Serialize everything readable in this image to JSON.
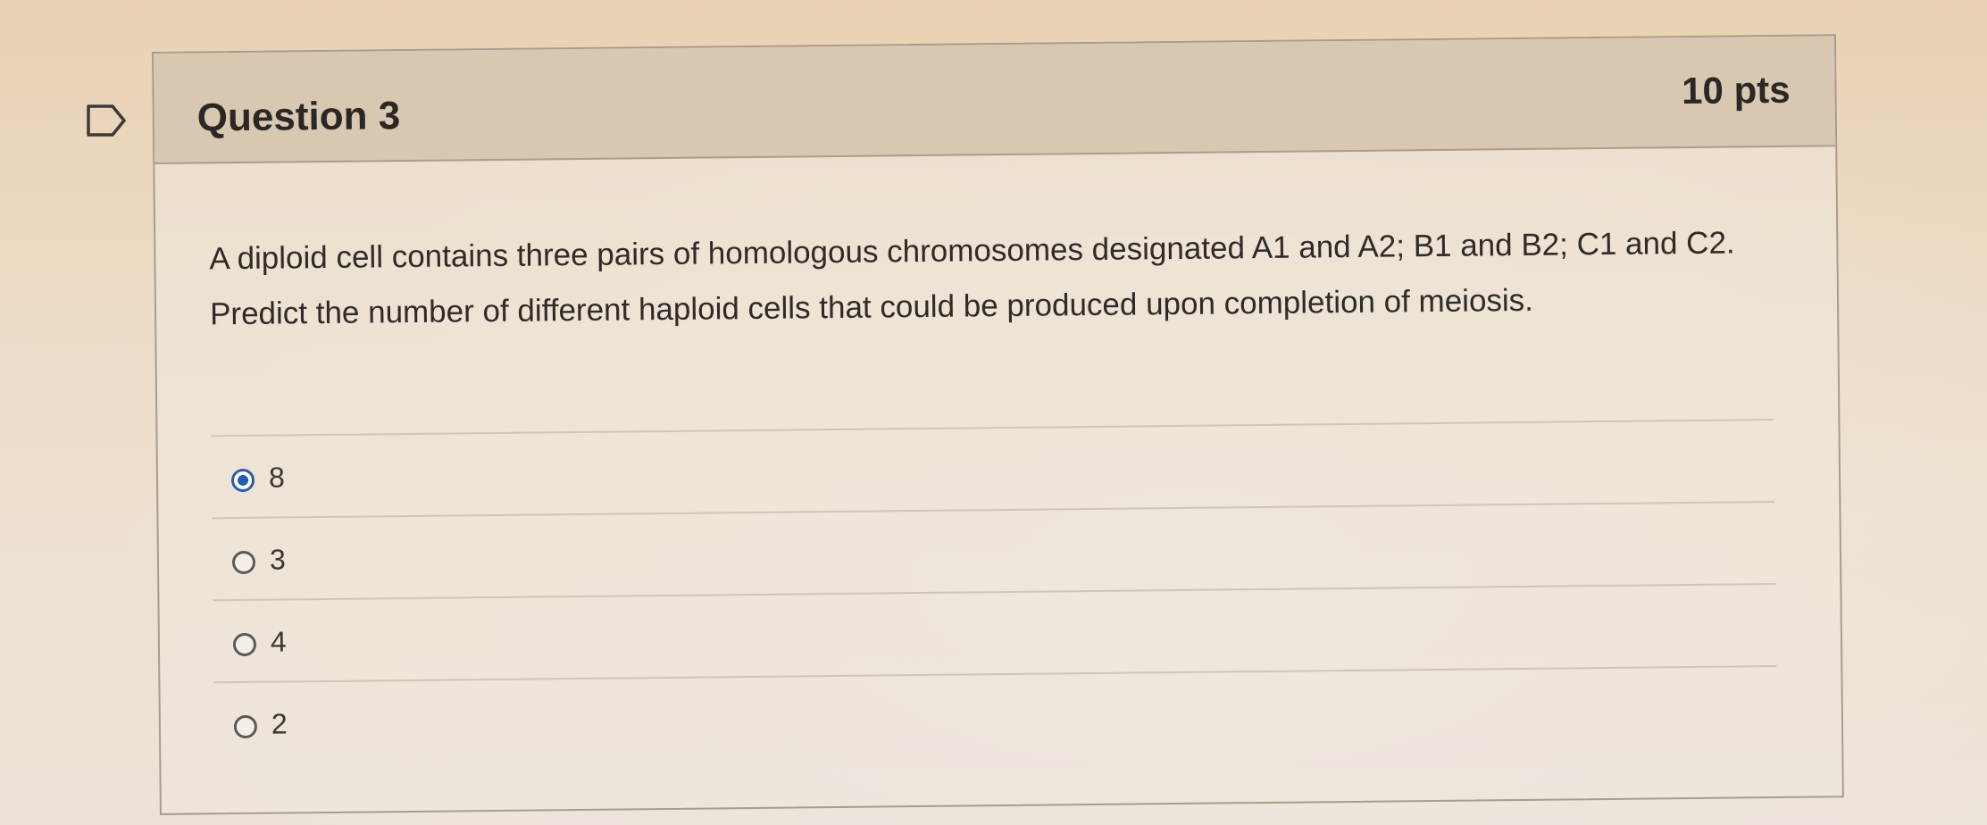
{
  "question": {
    "title": "Question 3",
    "points": "10 pts",
    "text": "A diploid cell contains three pairs of homologous chromosomes designated A1 and A2; B1 and B2; C1 and C2. Predict the number of different haploid cells that could be produced upon completion of meiosis."
  },
  "answers": [
    {
      "label": "8",
      "selected": true
    },
    {
      "label": "3",
      "selected": false
    },
    {
      "label": "4",
      "selected": false
    },
    {
      "label": "2",
      "selected": false
    }
  ],
  "colors": {
    "header_bg": "#d9c8b1",
    "radio_selected": "#1f5fb3",
    "text": "#2b2724"
  },
  "icons": {
    "flag": "flag-outline-icon"
  }
}
